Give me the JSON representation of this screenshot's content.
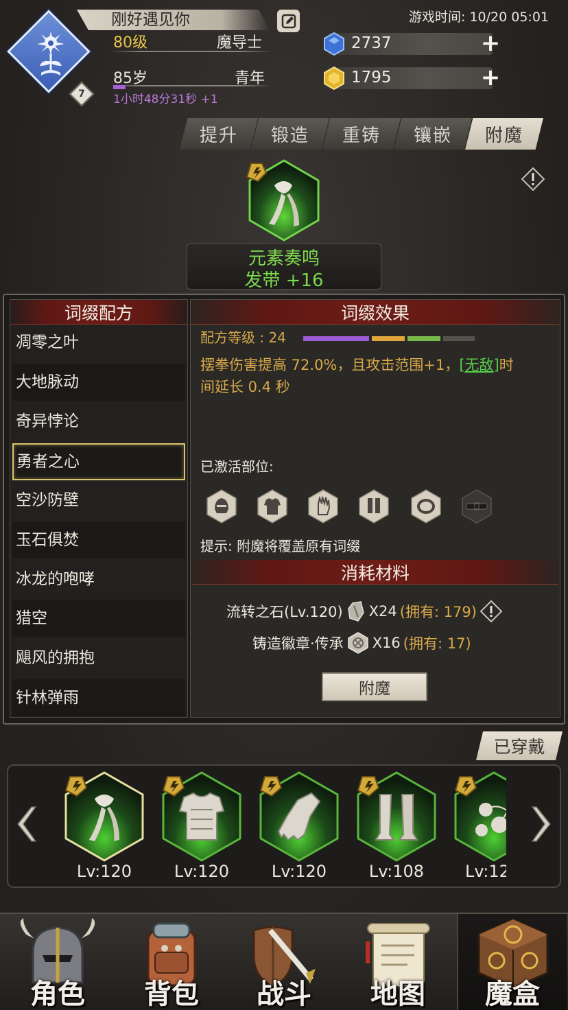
{
  "player": {
    "name": "刚好遇见你",
    "level": "80级",
    "class": "魔导士",
    "age": "85岁",
    "stage": "青年",
    "timer": "1小时48分31秒 +1",
    "badge_level": "7"
  },
  "header": {
    "game_time": "游戏时间: 10/20 05:01",
    "diamonds": "2737",
    "gold": "1795"
  },
  "tabs": [
    {
      "label": "提升",
      "active": false
    },
    {
      "label": "锻造",
      "active": false
    },
    {
      "label": "重铸",
      "active": false
    },
    {
      "label": "镶嵌",
      "active": false
    },
    {
      "label": "附魔",
      "active": true
    }
  ],
  "featured_item": {
    "set_name": "元素奏鸣",
    "item_name": "发带 +16"
  },
  "recipe_panel": {
    "title": "词缀配方",
    "items": [
      "凋零之叶",
      "大地脉动",
      "奇异悖论",
      "勇者之心",
      "空沙防壁",
      "玉石俱焚",
      "冰龙的咆哮",
      "猎空",
      "飓风的拥抱",
      "针林弹雨"
    ],
    "selected_index": 3
  },
  "effect_panel": {
    "title": "词缀效果",
    "recipe_level": "配方等级 : 24",
    "effect_part1": "摆拳伤害提高 72.0%，且攻击范围+1，",
    "effect_keyword": "[无敌]",
    "effect_part2": "时",
    "effect_line2": "间延长 0.4 秒",
    "activated_label": "已激活部位:",
    "slots": [
      "helmet-icon",
      "armor-icon",
      "glove-icon",
      "leg-icon",
      "ring-icon",
      "belt-icon"
    ],
    "tip": "提示: 附魔将覆盖原有词缀",
    "materials_title": "消耗材料",
    "materials": [
      {
        "name": "流转之石(Lv.120)",
        "qty": "X24",
        "own": "(拥有: 179)"
      },
      {
        "name": "铸造徽章·传承",
        "qty": "X16",
        "own": "(拥有: 17)"
      }
    ],
    "button": "附魔"
  },
  "equipped": {
    "tag": "已穿戴",
    "items": [
      {
        "icon": "headband-icon",
        "lv": "Lv:120"
      },
      {
        "icon": "chest-armor-icon",
        "lv": "Lv:120"
      },
      {
        "icon": "gauntlet-icon",
        "lv": "Lv:120"
      },
      {
        "icon": "greaves-icon",
        "lv": "Lv:108"
      },
      {
        "icon": "necklace-icon",
        "lv": "Lv:12"
      }
    ]
  },
  "nav": [
    {
      "label": "角色",
      "icon": "helmet-icon"
    },
    {
      "label": "背包",
      "icon": "backpack-icon"
    },
    {
      "label": "战斗",
      "icon": "sword-shield-icon"
    },
    {
      "label": "地图",
      "icon": "scroll-icon"
    },
    {
      "label": "魔盒",
      "icon": "magic-box-icon"
    }
  ],
  "colors": {
    "green": "#7dd84e",
    "gold": "#d9a94a",
    "accent_red": "#6e1c16"
  }
}
